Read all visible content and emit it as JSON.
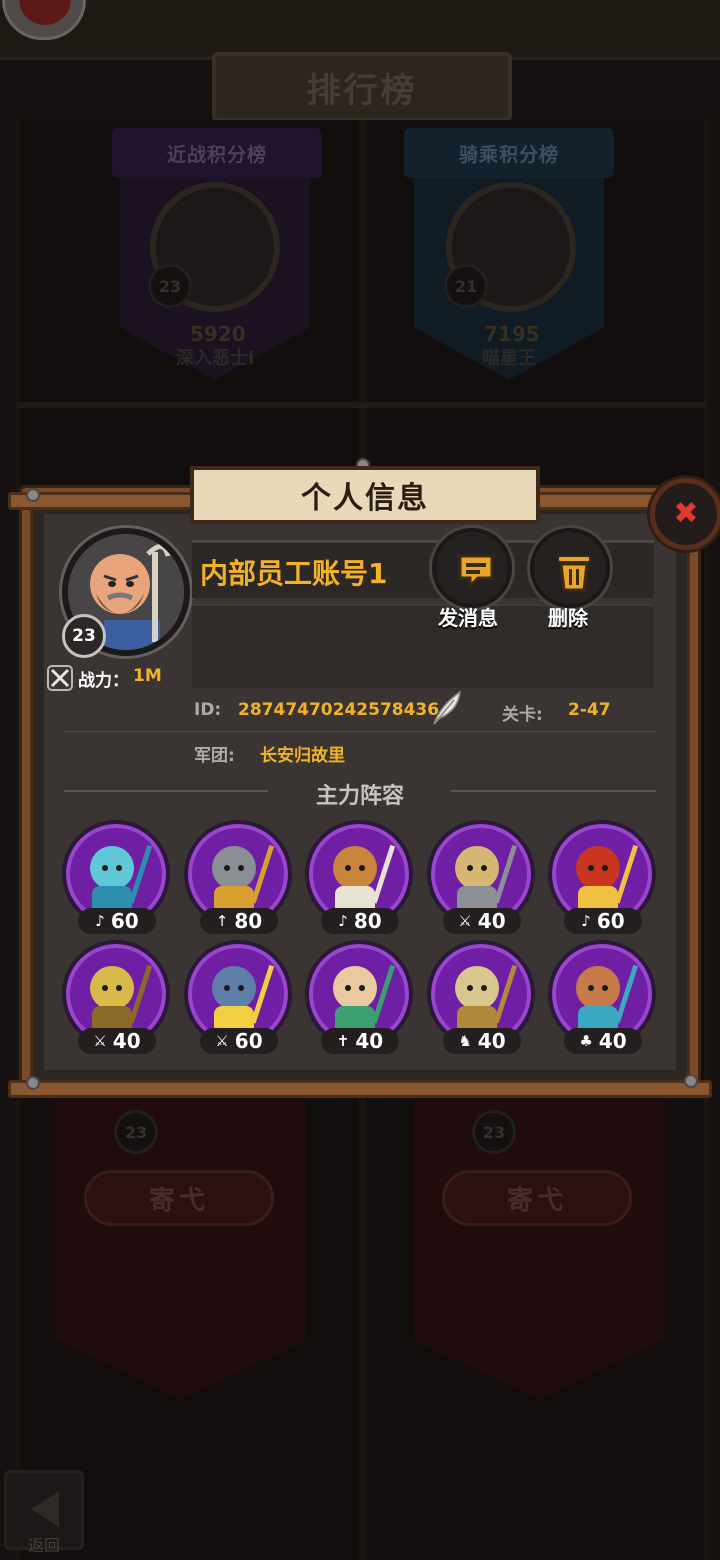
{
  "background": {
    "title": "排行榜",
    "boards": [
      {
        "label": "近战积分榜",
        "level": "23",
        "score": "5920",
        "player": "深入恶士i"
      },
      {
        "label": "骑乘积分榜",
        "level": "21",
        "score": "7195",
        "player": "喵星王"
      }
    ],
    "lower_cards": [
      {
        "level": "23",
        "label": "寄弋"
      },
      {
        "level": "23",
        "label": "寄弋"
      }
    ],
    "back_label": "返回"
  },
  "dialog": {
    "title": "个人信息",
    "close_symbol": "✖",
    "player": {
      "name": "内部员工账号1",
      "level": "23",
      "power_label": "战力：",
      "power_value": "1M",
      "id_label": "ID:",
      "id_value": "28747470242578436",
      "stage_label": "关卡:",
      "stage_value": "2-47",
      "guild_label": "军团:",
      "guild_value": "长安归故里"
    },
    "actions": {
      "message_label": "发消息",
      "delete_label": "删除"
    },
    "lineup_title": "主力阵容",
    "heroes": [
      {
        "class_icon": "bard-icon",
        "class_glyph": "♪",
        "level": "60",
        "skin": "#5fc7d6",
        "accent": "#2d8fb0"
      },
      {
        "class_icon": "spear-icon",
        "class_glyph": "↑",
        "level": "80",
        "skin": "#8a8f96",
        "accent": "#d8a030"
      },
      {
        "class_icon": "bard-icon",
        "class_glyph": "♪",
        "level": "80",
        "skin": "#c9853a",
        "accent": "#e8e2d2"
      },
      {
        "class_icon": "sword-icon",
        "class_glyph": "⚔",
        "level": "40",
        "skin": "#d6b874",
        "accent": "#8c8f96"
      },
      {
        "class_icon": "bard-icon",
        "class_glyph": "♪",
        "level": "60",
        "skin": "#c8361f",
        "accent": "#f0c040"
      },
      {
        "class_icon": "sword-icon",
        "class_glyph": "⚔",
        "level": "40",
        "skin": "#d9b94a",
        "accent": "#8a6a2a"
      },
      {
        "class_icon": "sword-icon",
        "class_glyph": "⚔",
        "level": "60",
        "skin": "#5e7fa8",
        "accent": "#f0d040"
      },
      {
        "class_icon": "cross-icon",
        "class_glyph": "✝",
        "level": "40",
        "skin": "#e8c9a0",
        "accent": "#3aa070"
      },
      {
        "class_icon": "cavalry-icon",
        "class_glyph": "♞",
        "level": "40",
        "skin": "#d8c890",
        "accent": "#b08a3a"
      },
      {
        "class_icon": "mount-icon",
        "class_glyph": "♣",
        "level": "40",
        "skin": "#c97a4a",
        "accent": "#3aa8c0"
      }
    ]
  }
}
